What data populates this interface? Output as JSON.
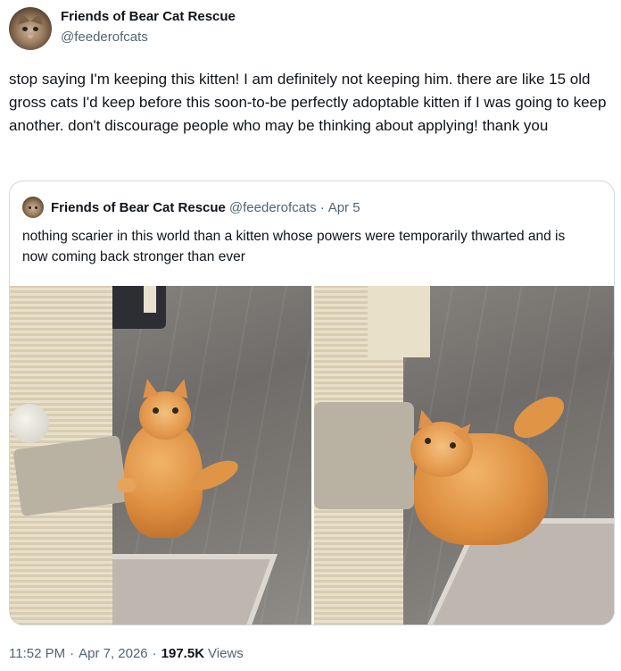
{
  "author": {
    "display_name": "Friends of Bear Cat Rescue",
    "handle": "@feederofcats"
  },
  "tweet": {
    "text": "stop saying I'm keeping this kitten! I am definitely not keeping him. there are like 15 old gross cats I'd keep before this soon-to-be perfectly adoptable kitten if I was going to keep another. don't discourage people who may be thinking about applying! thank you"
  },
  "quoted_tweet": {
    "display_name": "Friends of Bear Cat Rescue",
    "handle": "@feederofcats",
    "separator": "·",
    "date": "Apr 5",
    "text": "nothing scarier in this world than a kitten whose powers were temporarily thwarted and is now coming back stronger than ever",
    "media": [
      "kitten-photo-standing",
      "kitten-photo-crouching"
    ]
  },
  "footer": {
    "time": "11:52 PM",
    "dot": "·",
    "date": "Apr 7, 2026",
    "views_count": "197.5K",
    "views_label": "Views"
  },
  "icons": [
    "avatar",
    "kitten-photo"
  ],
  "colors": {
    "text": "#0f1419",
    "secondary_text": "#536471",
    "border": "#cfd9de",
    "background": "#ffffff"
  }
}
